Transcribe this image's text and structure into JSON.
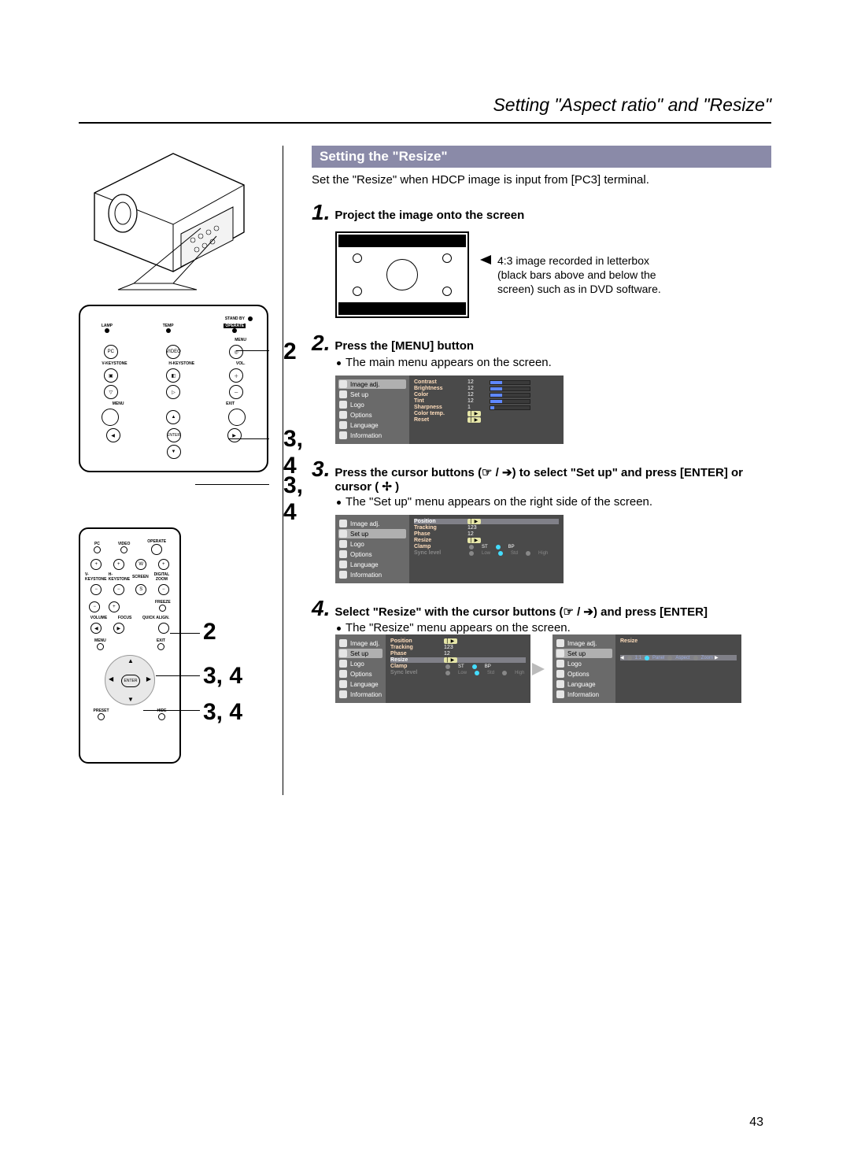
{
  "page": {
    "title": "Setting \"Aspect ratio\" and \"Resize\"",
    "number": "43"
  },
  "section": {
    "bar": "Setting the \"Resize\"",
    "intro": "Set the \"Resize\" when HDCP image is input from [PC3] terminal."
  },
  "steps": {
    "s1": {
      "num": "1.",
      "title": "Project the image onto the screen",
      "caption": "4:3 image recorded in letterbox (black bars above and below the screen) such as in DVD software."
    },
    "s2": {
      "num": "2.",
      "title": "Press the [MENU] button",
      "bullet": "The main menu appears on the screen."
    },
    "s3": {
      "num": "3.",
      "title": "Press the cursor buttons (☞ / ➔) to select \"Set up\" and press [ENTER] or cursor ( ✢ )",
      "bullet": "The \"Set up\" menu appears on the right side of the screen."
    },
    "s4": {
      "num": "4.",
      "title": "Select \"Resize\" with the cursor buttons (☞ / ➔) and press [ENTER]",
      "bullet": "The \"Resize\" menu appears on the screen."
    }
  },
  "panel": {
    "standby": "STAND BY",
    "lamp": "LAMP",
    "temp": "TEMP",
    "operate": "OPERATE",
    "menu_lbl": "MENU",
    "pc": "PC",
    "video": "VIDEO",
    "vkeystone": "V-KEYSTONE",
    "hkeystone": "H-KEYSTONE",
    "vol": "VOL.",
    "menu": "MENU",
    "exit": "EXIT",
    "enter": "ENTER"
  },
  "remote": {
    "pc": "PC",
    "video": "VIDEO",
    "operate": "OPERATE",
    "vkey": "V-KEYSTONE",
    "hkey": "H-KEYSTONE",
    "screen": "SCREEN",
    "dzoom": "DIGITAL ZOOM",
    "volume": "VOLUME",
    "focus": "FOCUS",
    "quick": "QUICK ALIGN.",
    "freeze": "FREEZE",
    "menu": "MENU",
    "exit": "EXIT",
    "enter": "ENTER",
    "preset": "PRESET",
    "hide": "HIDE"
  },
  "callouts": {
    "p2": "2",
    "p34a": "3, 4",
    "p34b": "3, 4",
    "r2": "2",
    "r34a": "3, 4",
    "r34b": "3, 4"
  },
  "menu_side": {
    "image_adj": "Image adj.",
    "set_up": "Set up",
    "logo": "Logo",
    "options": "Options",
    "language": "Language",
    "information": "Information"
  },
  "menu1": {
    "contrast": "Contrast",
    "contrast_v": "12",
    "brightness": "Brightness",
    "brightness_v": "12",
    "color": "Color",
    "color_v": "12",
    "tint": "Tint",
    "tint_v": "12",
    "sharpness": "Sharpness",
    "sharpness_v": "1",
    "colortemp": "Color temp.",
    "reset": "Reset"
  },
  "menu2": {
    "position": "Position",
    "tracking": "Tracking",
    "tracking_v": "123",
    "phase": "Phase",
    "phase_v": "12",
    "resize": "Resize",
    "clamp": "Clamp",
    "clamp_st": "ST",
    "clamp_bp": "BP",
    "sync": "Sync level",
    "sync_low": "Low",
    "sync_std": "Std",
    "sync_high": "High"
  },
  "menu3": {
    "resize_title": "Resize",
    "opt11": "1:1",
    "opt_panel": "Panel",
    "opt_aspect": "Aspect",
    "opt_zoom": "Zoom"
  }
}
